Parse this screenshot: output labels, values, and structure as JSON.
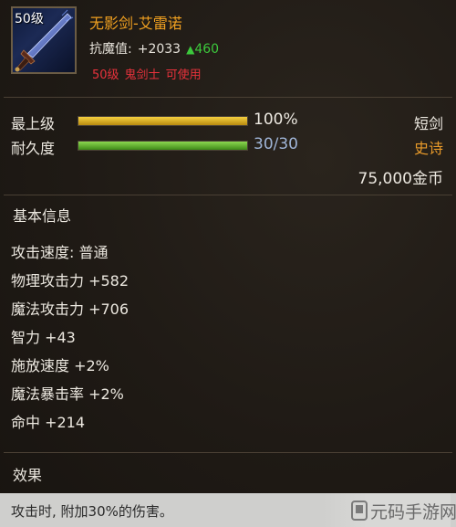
{
  "item": {
    "level_badge": "50级",
    "name": "无影剑-艾雷诺",
    "resist_label": "抗魔值:",
    "resist_value": "+2033",
    "resist_bonus": "460",
    "requirements": [
      "50级",
      "鬼剑士",
      "可使用"
    ],
    "icon": "sword-icon"
  },
  "stats": {
    "upgrade": {
      "label": "最上级",
      "value": "100%",
      "fraction": 1.0,
      "color": "#e8b820"
    },
    "durability": {
      "label": "耐久度",
      "value": "30/30",
      "fraction": 1.0,
      "color": "#6cc43a"
    },
    "type": "短剑",
    "rarity": "史诗",
    "rarity_color": "#e89a2a",
    "price": "75,000金币"
  },
  "basic_info": {
    "title": "基本信息",
    "attributes": [
      "攻击速度: 普通",
      "物理攻击力 +582",
      "魔法攻击力 +706",
      "智力 +43",
      "施放速度 +2%",
      "魔法暴击率 +2%",
      "命中 +214"
    ]
  },
  "effect": {
    "title": "效果",
    "text": "攻击时, 附加30%的伤害。"
  },
  "watermark": {
    "text": "元码手游网"
  }
}
